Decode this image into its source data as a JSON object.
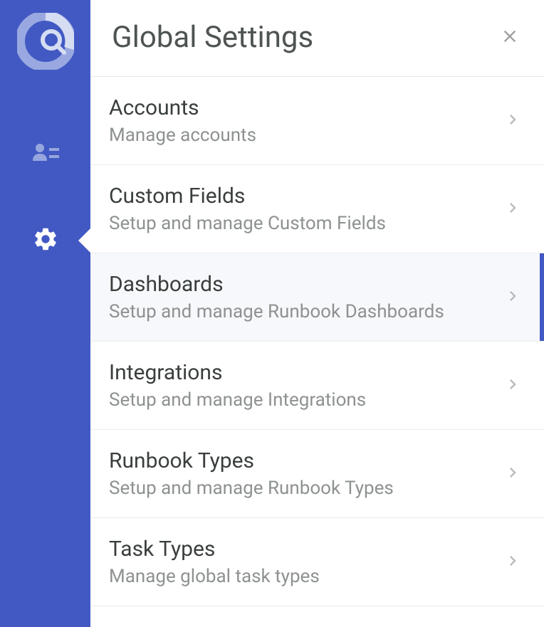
{
  "header": {
    "title": "Global Settings"
  },
  "settings": [
    {
      "title": "Accounts",
      "description": "Manage accounts",
      "selected": false
    },
    {
      "title": "Custom Fields",
      "description": "Setup and manage Custom Fields",
      "selected": false
    },
    {
      "title": "Dashboards",
      "description": "Setup and manage Runbook Dashboards",
      "selected": true
    },
    {
      "title": "Integrations",
      "description": "Setup and manage Integrations",
      "selected": false
    },
    {
      "title": "Runbook Types",
      "description": "Setup and manage Runbook Types",
      "selected": false
    },
    {
      "title": "Task Types",
      "description": "Manage global task types",
      "selected": false
    }
  ]
}
